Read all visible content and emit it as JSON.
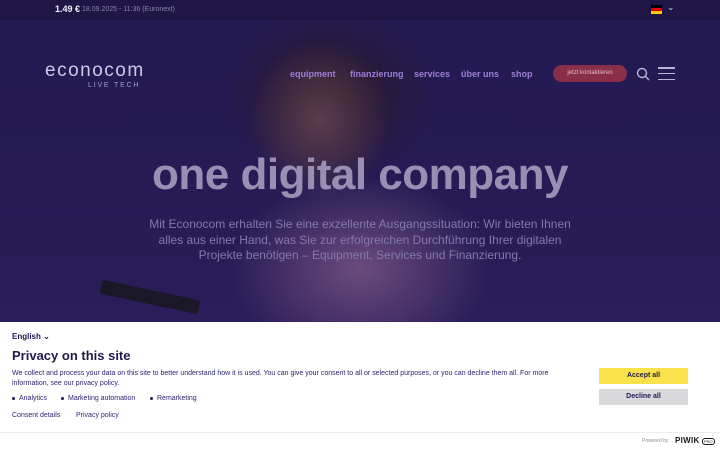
{
  "topbar": {
    "price": "1.49 €",
    "stock_meta": "18.09.2025 - 11:36 (Euronext)",
    "flag_colors": [
      "#000000",
      "#dd0000",
      "#ffce00"
    ]
  },
  "header": {
    "logo_word": "econocom",
    "logo_sub": "LIVE TECH",
    "nav": [
      "equipment",
      "finanzierung",
      "services",
      "über uns",
      "shop"
    ],
    "cta_label": "jetzt kontaktieren"
  },
  "hero": {
    "headline": "one digital company",
    "intro": "Mit Econocom erhalten Sie eine exzellente Ausgangssituation: Wir bieten Ihnen alles aus einer Hand, was Sie zur erfolgreichen Durchführung Ihrer digitalen Projekte benötigen – Equipment, Services und Finanzierung."
  },
  "consent": {
    "language": "English",
    "title": "Privacy on this site",
    "description": "We collect and process your data on this site to better understand how it is used. You can give your consent to all or selected purposes, or you can decline them all. For more information, see our privacy policy.",
    "purposes": [
      "Analytics",
      "Marketing automation",
      "Remarketing"
    ],
    "links": [
      "Consent details",
      "Privacy policy"
    ],
    "accept_label": "Accept all",
    "decline_label": "Decline all",
    "accent_color": "#f9e14b"
  },
  "footer": {
    "powered_by": "Powered by",
    "brand": "PIWIK",
    "brand_badge": "PRO"
  }
}
